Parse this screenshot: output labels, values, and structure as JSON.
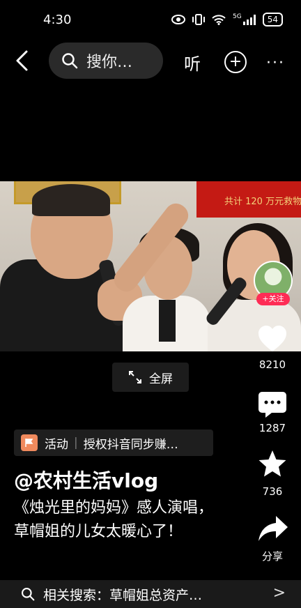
{
  "status_bar": {
    "time": "4:30",
    "signal_label": "5G",
    "battery": "54"
  },
  "top_bar": {
    "search_text": "搜你…",
    "listen_label": "听",
    "plus_symbol": "+",
    "more_symbol": "···"
  },
  "video": {
    "banner_text": "共计 120 万元救物"
  },
  "fullscreen_label": "全屏",
  "right_rail": {
    "follow_label": "+关注",
    "likes": "8210",
    "comments": "1287",
    "favorites": "736",
    "share_label": "分享"
  },
  "activity": {
    "tag": "活动",
    "text": "授权抖音同步赚…"
  },
  "author": "@农村生活vlog",
  "description": "《烛光里的妈妈》感人演唱，草帽姐的儿女太暖心了！",
  "related": {
    "text": "相关搜索：草帽姐总资产…",
    "chevron": ">"
  },
  "colors": {
    "background": "#000000",
    "follow_red": "#fe2c55",
    "activity_icon": "#f08a5d"
  }
}
